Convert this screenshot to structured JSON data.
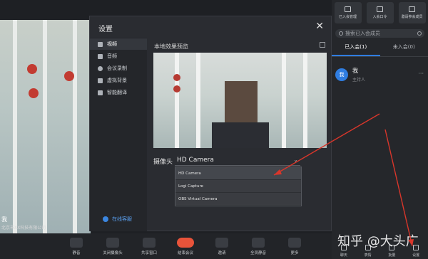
{
  "main_video": {
    "name": "我",
    "subtitle": "北京市XX科技有限公司"
  },
  "dialog": {
    "title": "设置",
    "close": "✕",
    "sidebar": [
      {
        "label": "视频",
        "icon": "video-icon",
        "active": true
      },
      {
        "label": "音频",
        "icon": "audio-icon",
        "active": false
      },
      {
        "label": "会议录制",
        "icon": "record-icon",
        "active": false
      },
      {
        "label": "虚拟背景",
        "icon": "background-icon",
        "active": false
      },
      {
        "label": "智能翻译",
        "icon": "translate-icon",
        "active": false
      }
    ],
    "feedback": "在线客服",
    "preview_label": "本地效果预览",
    "camera_label": "摄像头",
    "camera_selected": "HD Camera",
    "camera_options": [
      "HD Camera",
      "Logi Capture",
      "OBS Virtual Camera"
    ]
  },
  "right_panel": {
    "top_buttons": [
      "已入会管理",
      "入会口令",
      "邀请参会成员"
    ],
    "search_placeholder": "搜索已入会成员",
    "tabs": [
      "已入会(1)",
      "未入会(0)"
    ],
    "member": {
      "avatar": "我",
      "name": "我",
      "role": "主持人",
      "more": "···"
    },
    "bottom_buttons": [
      "聊天",
      "表情",
      "批量",
      "设置"
    ]
  },
  "watermark": "知乎 @大头广",
  "toolbar": [
    {
      "label": "静音",
      "icon": "mic-icon"
    },
    {
      "label": "关闭摄像头",
      "icon": "camera-icon"
    },
    {
      "label": "共享窗口",
      "icon": "share-icon"
    },
    {
      "label": "结束会议",
      "icon": "hangup-icon"
    },
    {
      "label": "邀请",
      "icon": "invite-icon"
    },
    {
      "label": "全员静音",
      "icon": "mute-all-icon"
    },
    {
      "label": "更多",
      "icon": "more-icon"
    }
  ],
  "colors": {
    "accent": "#2f7de1",
    "hangup": "#e8533a",
    "annotation": "#d9362b"
  }
}
